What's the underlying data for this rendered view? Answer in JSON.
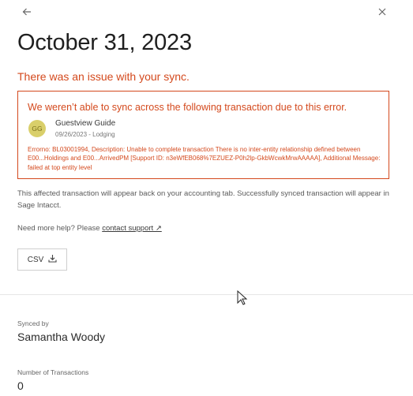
{
  "header": {
    "back_icon": "back-arrow-icon",
    "close_icon": "close-icon"
  },
  "title": "October 31, 2023",
  "issue_text": "There was an issue with your sync.",
  "error_box": {
    "heading": "We weren’t able to sync across the following transaction due to this error.",
    "avatar_initials": "GG",
    "transaction_name": "Guestview Guide",
    "transaction_meta": "09/26/2023 - Lodging",
    "detail": "Errorno: BL03001994, Description: Unable to complete transaction There is no inter-entity relationship defined between E00...Holdings and E00...ArrivedPM [Support ID: n3eWfEB068%7EZUEZ-P0h2lp-GkbWcwkMrwAAAAA], Additional Message: failed at top entity level"
  },
  "info_text": "This affected transaction will appear back on your accounting tab. Successfully synced transaction will appear in Sage Intacct.",
  "help": {
    "prefix": "Need more help? Please ",
    "link_label": "contact support ↗"
  },
  "csv_button": {
    "label": "CSV",
    "icon": "download-icon"
  },
  "synced_by": {
    "label": "Synced by",
    "value": "Samantha Woody"
  },
  "transactions": {
    "label": "Number of Transactions",
    "value": "0"
  },
  "colors": {
    "error": "#d4491d",
    "avatar_bg": "#d9cf6a"
  }
}
